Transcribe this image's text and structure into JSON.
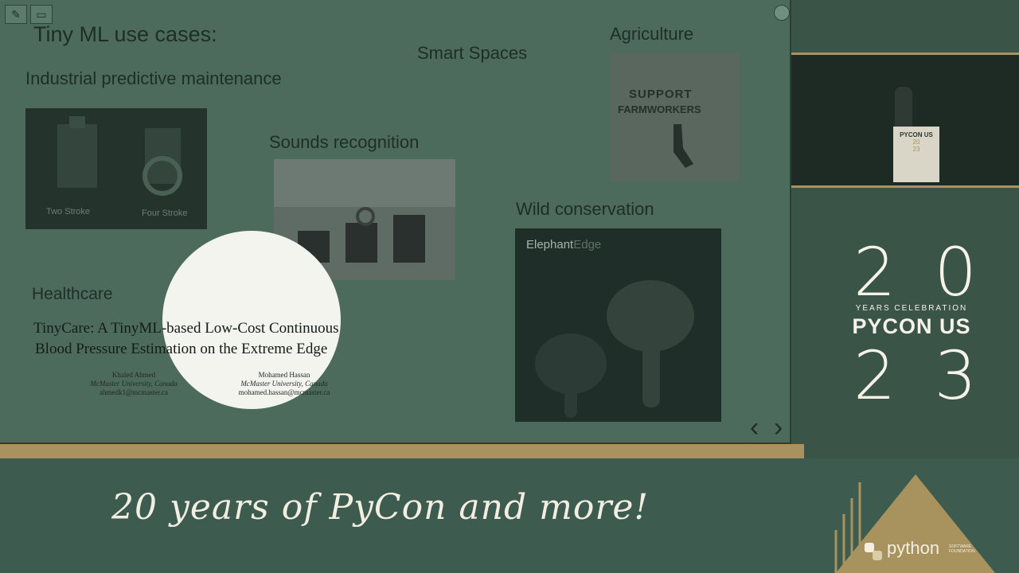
{
  "slide": {
    "title": "Tiny ML use cases:",
    "industrial": {
      "heading": "Industrial predictive maintenance",
      "caption_left": "Two Stroke",
      "caption_right": "Four Stroke"
    },
    "smart_spaces": "Smart Spaces",
    "sounds": "Sounds recognition",
    "agriculture": {
      "heading": "Agriculture",
      "poster_line1": "SUPPORT",
      "poster_line2": "FARMWORKERS"
    },
    "wild": {
      "heading": "Wild conservation",
      "brand_part1": "Elephant",
      "brand_part2": "Edge"
    },
    "healthcare": {
      "heading": "Healthcare",
      "paper_title_line1": "TinyCare: A TinyML-based Low-Cost Continuous",
      "paper_title_line2": "Blood Pressure Estimation on the Extreme Edge",
      "author1_name": "Khaled Ahmed",
      "author1_affil": "McMaster University, Canada",
      "author1_email": "ahmedk1@mcmaster.ca",
      "author2_name": "Mohamed Hassan",
      "author2_affil": "McMaster University, Canada",
      "author2_email": "mohamed.hassan@mcmaster.ca"
    },
    "nav": {
      "prev": "‹",
      "next": "›"
    }
  },
  "toolbar": {
    "pen_icon": "pencil-icon",
    "box_icon": "frame-icon"
  },
  "event": {
    "year_top": "20",
    "celebration": "YEARS CELEBRATION",
    "name": "PYCON US",
    "year_bottom": "23",
    "podium_text": "PYCON US",
    "podium_year_top": "20",
    "podium_year_bottom": "23"
  },
  "banner": {
    "tagline": "20 years of PyCon and more!",
    "sponsor": "python",
    "sponsor_sub": "SOFTWARE FOUNDATION"
  },
  "colors": {
    "gold": "#a8935e",
    "slide_bg": "#4d6b5d",
    "band_bg": "#3d5b4f"
  }
}
